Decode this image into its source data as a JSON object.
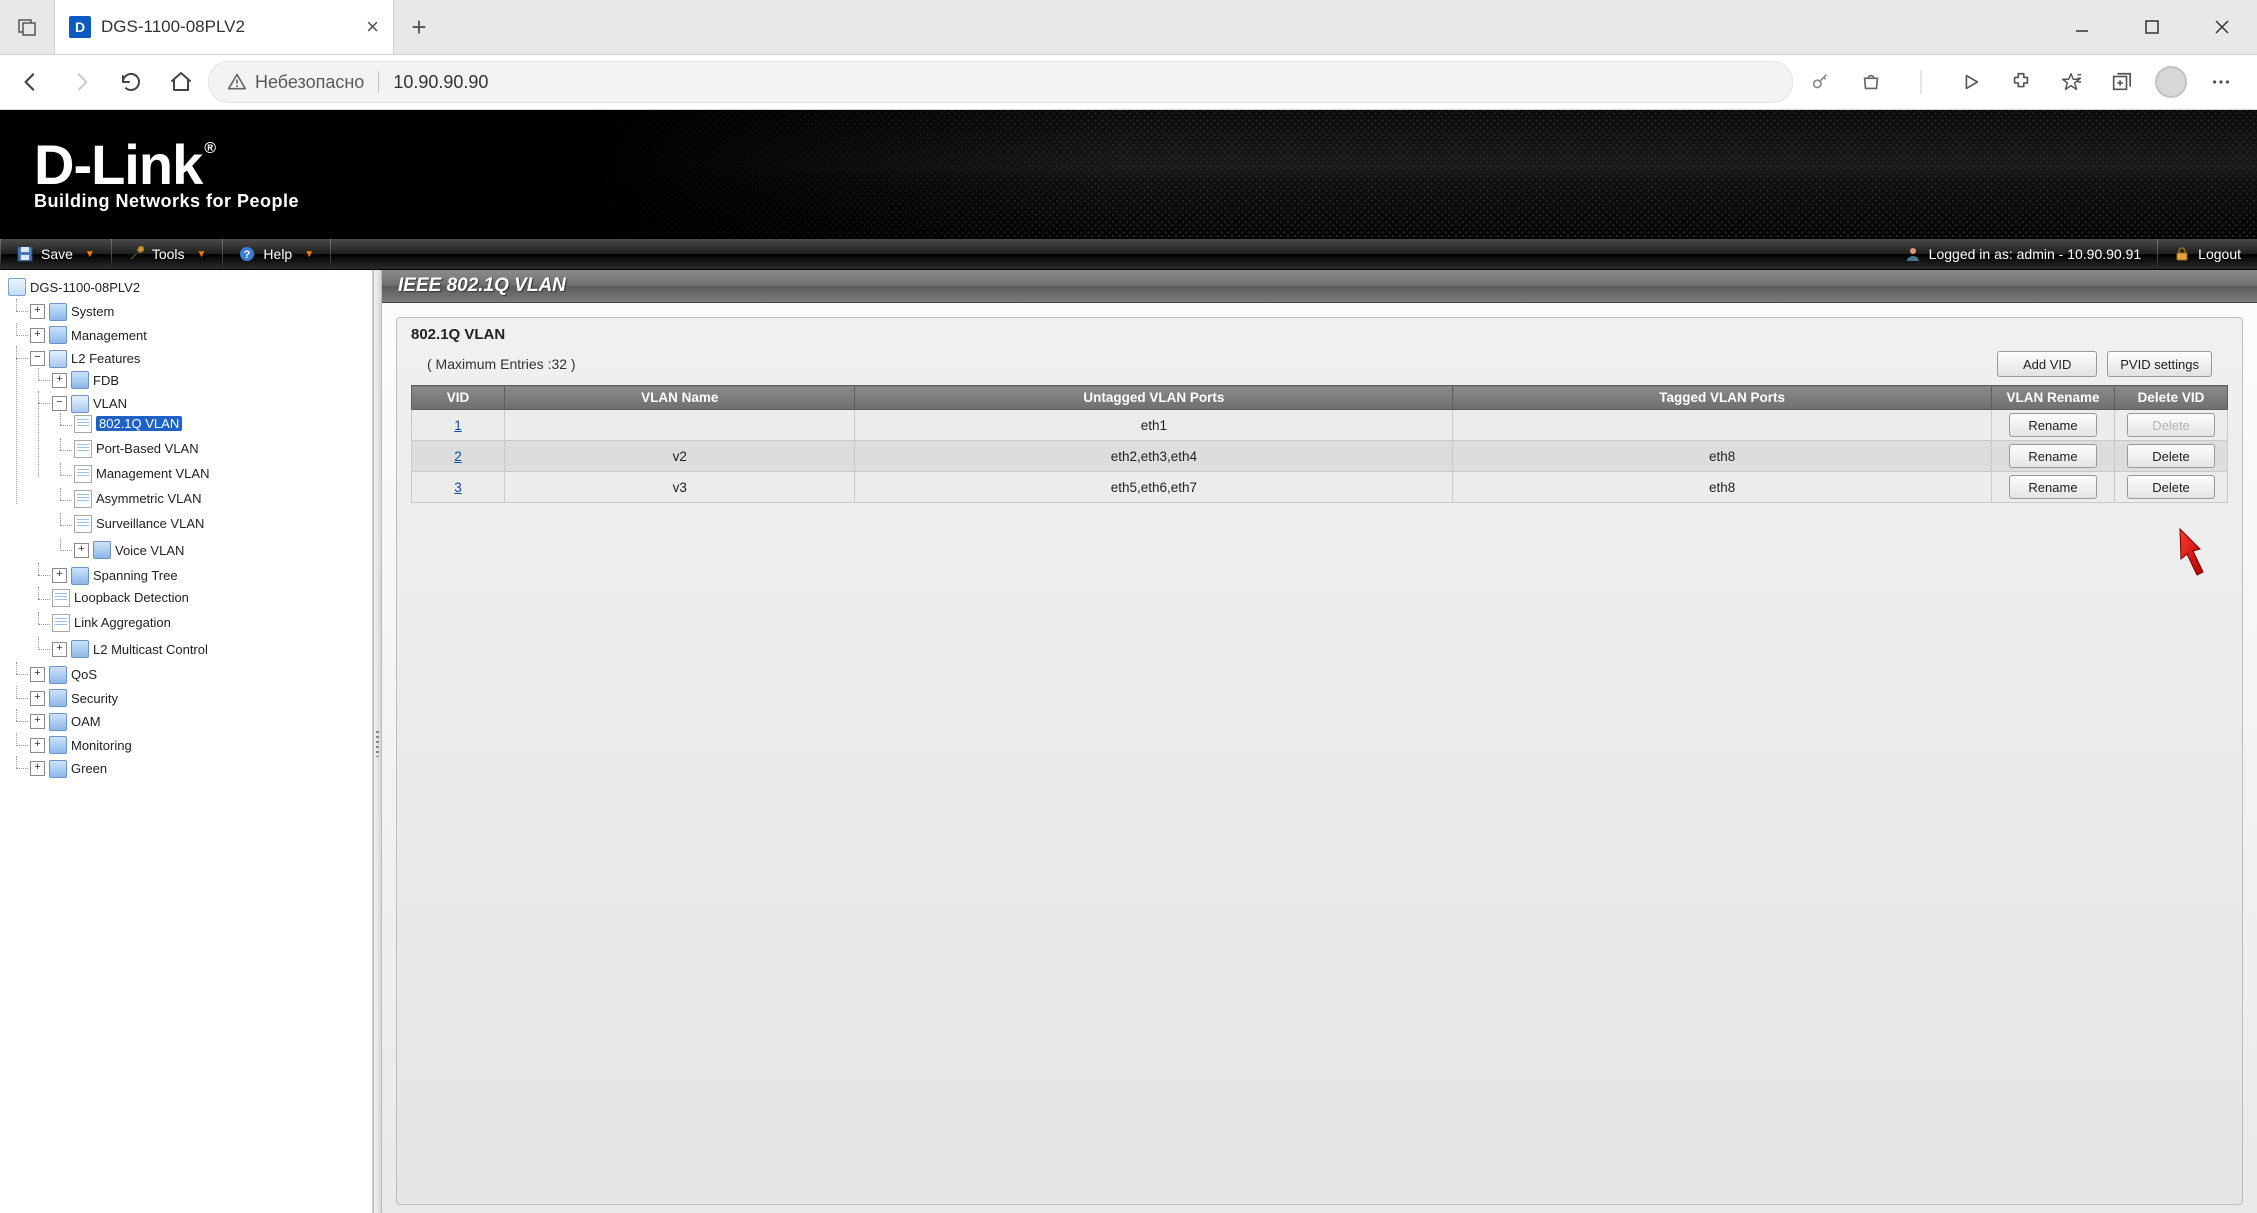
{
  "browser": {
    "tab_title": "DGS-1100-08PLV2",
    "security_label": "Небезопасно",
    "url": "10.90.90.90"
  },
  "menubar": {
    "save": "Save",
    "tools": "Tools",
    "help": "Help",
    "logged_in": "Logged in as: admin - 10.90.90.91",
    "logout": "Logout"
  },
  "logo": {
    "main": "D-Link",
    "sub": "Building Networks for People"
  },
  "tree": {
    "root": "DGS-1100-08PLV2",
    "system": "System",
    "management": "Management",
    "l2": "L2 Features",
    "fdb": "FDB",
    "vlan": "VLAN",
    "vlan_8021q": "802.1Q VLAN",
    "vlan_port": "Port-Based VLAN",
    "vlan_mgmt": "Management VLAN",
    "vlan_asym": "Asymmetric VLAN",
    "vlan_surv": "Surveillance VLAN",
    "vlan_voice": "Voice VLAN",
    "stp": "Spanning Tree",
    "loop": "Loopback Detection",
    "lag": "Link Aggregation",
    "l2mc": "L2 Multicast Control",
    "qos": "QoS",
    "security": "Security",
    "oam": "OAM",
    "monitoring": "Monitoring",
    "green": "Green"
  },
  "content": {
    "title": "IEEE 802.1Q VLAN",
    "panel_header": "802.1Q VLAN",
    "max_entries": "( Maximum Entries :32 )",
    "add_vid": "Add VID",
    "pvid_settings": "PVID settings",
    "headers": {
      "vid": "VID",
      "name": "VLAN Name",
      "untag": "Untagged VLAN Ports",
      "tag": "Tagged VLAN Ports",
      "rename": "VLAN Rename",
      "delete": "Delete VID"
    },
    "rename_label": "Rename",
    "delete_label": "Delete",
    "rows": [
      {
        "vid": "1",
        "name": "",
        "untag": "eth1",
        "tag": "",
        "del_disabled": true
      },
      {
        "vid": "2",
        "name": "v2",
        "untag": "eth2,eth3,eth4",
        "tag": "eth8",
        "del_disabled": false
      },
      {
        "vid": "3",
        "name": "v3",
        "untag": "eth5,eth6,eth7",
        "tag": "eth8",
        "del_disabled": false
      }
    ]
  }
}
